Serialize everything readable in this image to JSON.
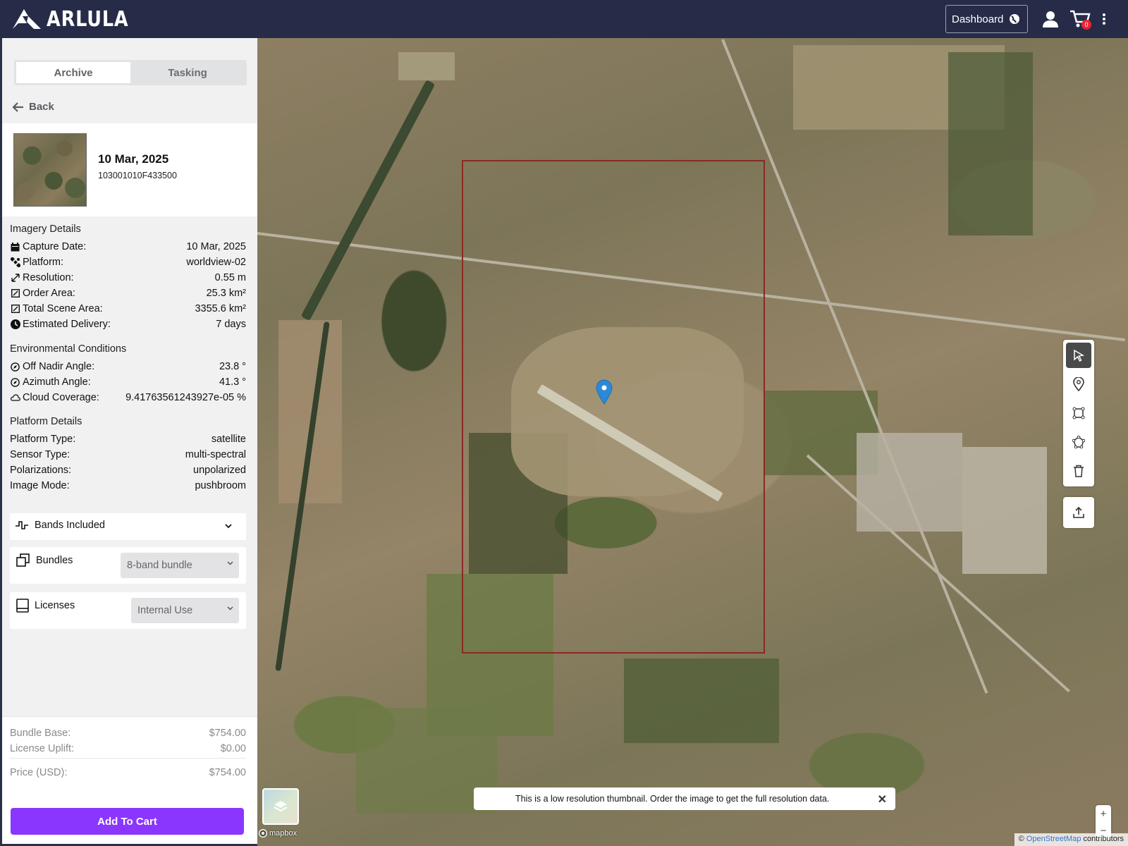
{
  "header": {
    "brand": "ARLULA",
    "dashboard_label": "Dashboard",
    "cart_count": "0",
    "icons": [
      "globe-icon",
      "user-icon",
      "cart-icon",
      "more-vertical-icon"
    ]
  },
  "sidebar": {
    "tabs": [
      {
        "label": "Archive",
        "active": true
      },
      {
        "label": "Tasking",
        "active": false
      }
    ],
    "back_label": "Back",
    "scene": {
      "date": "10 Mar, 2025",
      "id": "103001010F433500"
    },
    "imagery_details": {
      "title": "Imagery Details",
      "rows": [
        {
          "icon": "calendar-icon",
          "label": "Capture Date:",
          "value": "10 Mar, 2025"
        },
        {
          "icon": "satellite-icon",
          "label": "Platform:",
          "value": "worldview-02"
        },
        {
          "icon": "resolution-icon",
          "label": "Resolution:",
          "value": "0.55 m"
        },
        {
          "icon": "area-icon",
          "label": "Order Area:",
          "value": "25.3 km²"
        },
        {
          "icon": "area-icon",
          "label": "Total Scene Area:",
          "value": "3355.6 km²"
        },
        {
          "icon": "clock-icon",
          "label": "Estimated Delivery:",
          "value": "7 days"
        }
      ]
    },
    "environmental_conditions": {
      "title": "Environmental Conditions",
      "rows": [
        {
          "icon": "compass-icon",
          "label": "Off Nadir Angle:",
          "value": "23.8 °"
        },
        {
          "icon": "compass-icon",
          "label": "Azimuth Angle:",
          "value": "41.3 °"
        },
        {
          "icon": "cloud-icon",
          "label": "Cloud Coverage:",
          "value": "9.41763561243927e-05 %"
        }
      ]
    },
    "platform_details": {
      "title": "Platform Details",
      "rows": [
        {
          "label": "Platform Type:",
          "value": "satellite"
        },
        {
          "label": "Sensor Type:",
          "value": "multi-spectral"
        },
        {
          "label": "Polarizations:",
          "value": "unpolarized"
        },
        {
          "label": "Image Mode:",
          "value": "pushbroom"
        }
      ]
    },
    "bands_label": "Bands Included",
    "bundles": {
      "label": "Bundles",
      "selected": "8-band bundle"
    },
    "licenses": {
      "label": "Licenses",
      "selected": "Internal Use"
    },
    "pricing": {
      "bundle_base_label": "Bundle Base:",
      "bundle_base_value": "$754.00",
      "license_uplift_label": "License Uplift:",
      "license_uplift_value": "$0.00",
      "price_label": "Price (USD):",
      "price_value": "$754.00"
    },
    "add_to_cart_label": "Add To Cart"
  },
  "map": {
    "notice": "This is a low resolution thumbnail. Order the image to get the full resolution data.",
    "mapbox_label": "mapbox",
    "attribution_prefix": "©",
    "attribution_link": "OpenStreetMap",
    "attribution_suffix": "contributors",
    "zoom_in": "+",
    "zoom_out": "−",
    "bbox_color": "#8a2a22",
    "marker_color": "#2b8ad8",
    "tools": [
      "select-pointer-icon",
      "location-pin-icon",
      "rectangle-draw-icon",
      "polygon-draw-icon",
      "trash-icon",
      "upload-icon"
    ]
  },
  "colors": {
    "header_bg": "#262c47",
    "accent": "#8a36ff"
  }
}
